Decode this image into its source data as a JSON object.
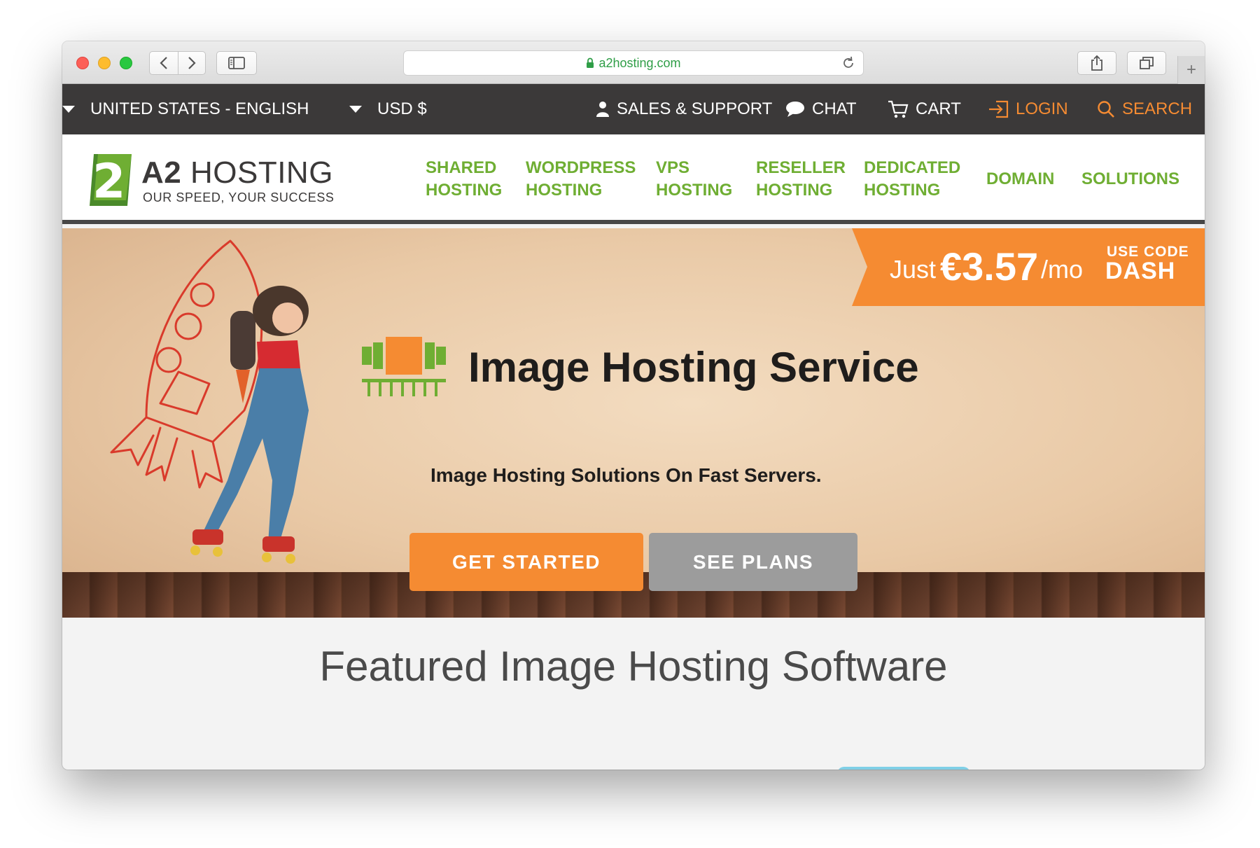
{
  "browser": {
    "url": "a2hosting.com"
  },
  "topbar": {
    "language": "UNITED STATES - ENGLISH",
    "currency": "USD $",
    "sales_support": "SALES & SUPPORT",
    "chat": "CHAT",
    "cart": "CART",
    "login": "LOGIN",
    "search": "SEARCH"
  },
  "logo": {
    "name_bold": "A2",
    "name_rest": "HOSTING",
    "tagline": "OUR SPEED, YOUR SUCCESS"
  },
  "nav": {
    "items": [
      {
        "line1": "SHARED",
        "line2": "HOSTING"
      },
      {
        "line1": "WORDPRESS",
        "line2": "HOSTING"
      },
      {
        "line1": "VPS",
        "line2": "HOSTING"
      },
      {
        "line1": "RESELLER",
        "line2": "HOSTING"
      },
      {
        "line1": "DEDICATED",
        "line2": "HOSTING"
      },
      {
        "line1": "DOMAIN",
        "line2": ""
      },
      {
        "line1": "SOLUTIONS",
        "line2": ""
      }
    ]
  },
  "promo": {
    "just": "Just",
    "price": "€3.57",
    "per": "/mo",
    "code_label": "USE CODE",
    "code": "DASH"
  },
  "hero": {
    "title": "Image Hosting Service",
    "subtitle": "Image Hosting Solutions On Fast Servers.",
    "cta_primary": "GET STARTED",
    "cta_secondary": "SEE PLANS"
  },
  "featured": {
    "title": "Featured Image Hosting Software"
  },
  "colors": {
    "brand_green": "#6fae33",
    "brand_orange": "#f58b32",
    "topbar_bg": "#3b3939",
    "secondary_button": "#9c9c9c"
  }
}
